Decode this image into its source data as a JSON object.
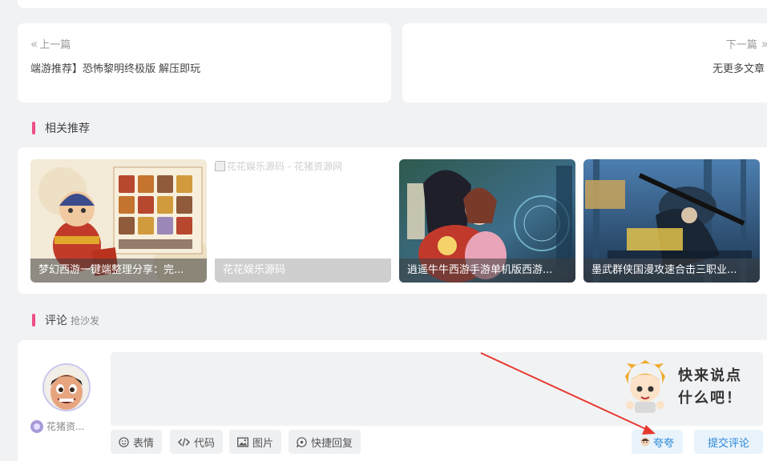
{
  "post_nav": {
    "prev": {
      "hint": "上一篇",
      "title": "端游推荐】恐怖黎明终极版 解压即玩"
    },
    "next": {
      "hint": "下一篇",
      "title": "无更多文章"
    }
  },
  "related": {
    "heading": "相关推荐",
    "items": [
      {
        "title": "梦幻西游一键端整理分享：完..."
      },
      {
        "title": "花花娱乐源码",
        "image_alt": "花花娱乐源码 - 花猪资源网"
      },
      {
        "title": "逍遥牛牛西游手游单机版西游..."
      },
      {
        "title": "墨武群侠国漫攻速合击三职业..."
      }
    ]
  },
  "comments": {
    "heading": "评论",
    "subheading": "抢沙发",
    "user_name": "花猪资...",
    "mascot_text": [
      "快来说点",
      "什么吧！"
    ],
    "toolbar": [
      {
        "label": "表情",
        "icon": "smile-icon"
      },
      {
        "label": "代码",
        "icon": "code-icon"
      },
      {
        "label": "图片",
        "icon": "image-icon"
      },
      {
        "label": "快捷回复",
        "icon": "chat-icon"
      }
    ],
    "praise_label": "夸夸",
    "submit_label": "提交评论"
  },
  "colors": {
    "accent_pink": "#ed4d88",
    "link_blue": "#2b87d8",
    "annotation_red": "#e8382e"
  }
}
